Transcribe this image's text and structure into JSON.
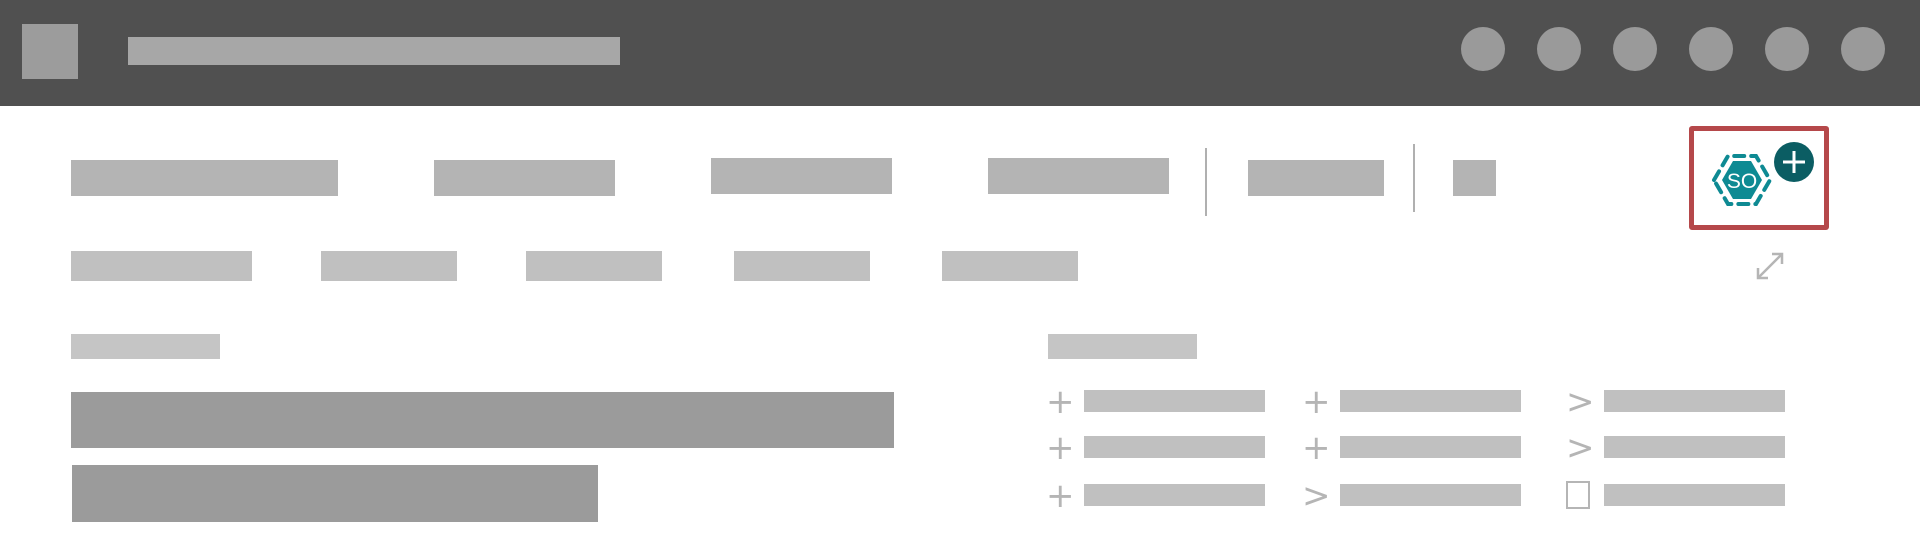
{
  "header": {
    "icons": [
      "circle-icon",
      "circle-icon",
      "circle-icon",
      "circle-icon",
      "circle-icon",
      "circle-icon"
    ]
  },
  "ribbon": {
    "add_icon": {
      "label": "SO",
      "name": "hexagon-add-icon",
      "color": "#0e8a93",
      "badge_color": "#0b5d63",
      "highlight_color": "#b5484a"
    },
    "expand_icon": "expand-icon"
  },
  "grid": {
    "symbols": [
      "+",
      "+",
      ">",
      "+",
      "+",
      ">",
      "+",
      ">"
    ]
  },
  "colors": {
    "topbar": "#505050",
    "accent": "#0e8a93",
    "highlight": "#b5484a"
  }
}
